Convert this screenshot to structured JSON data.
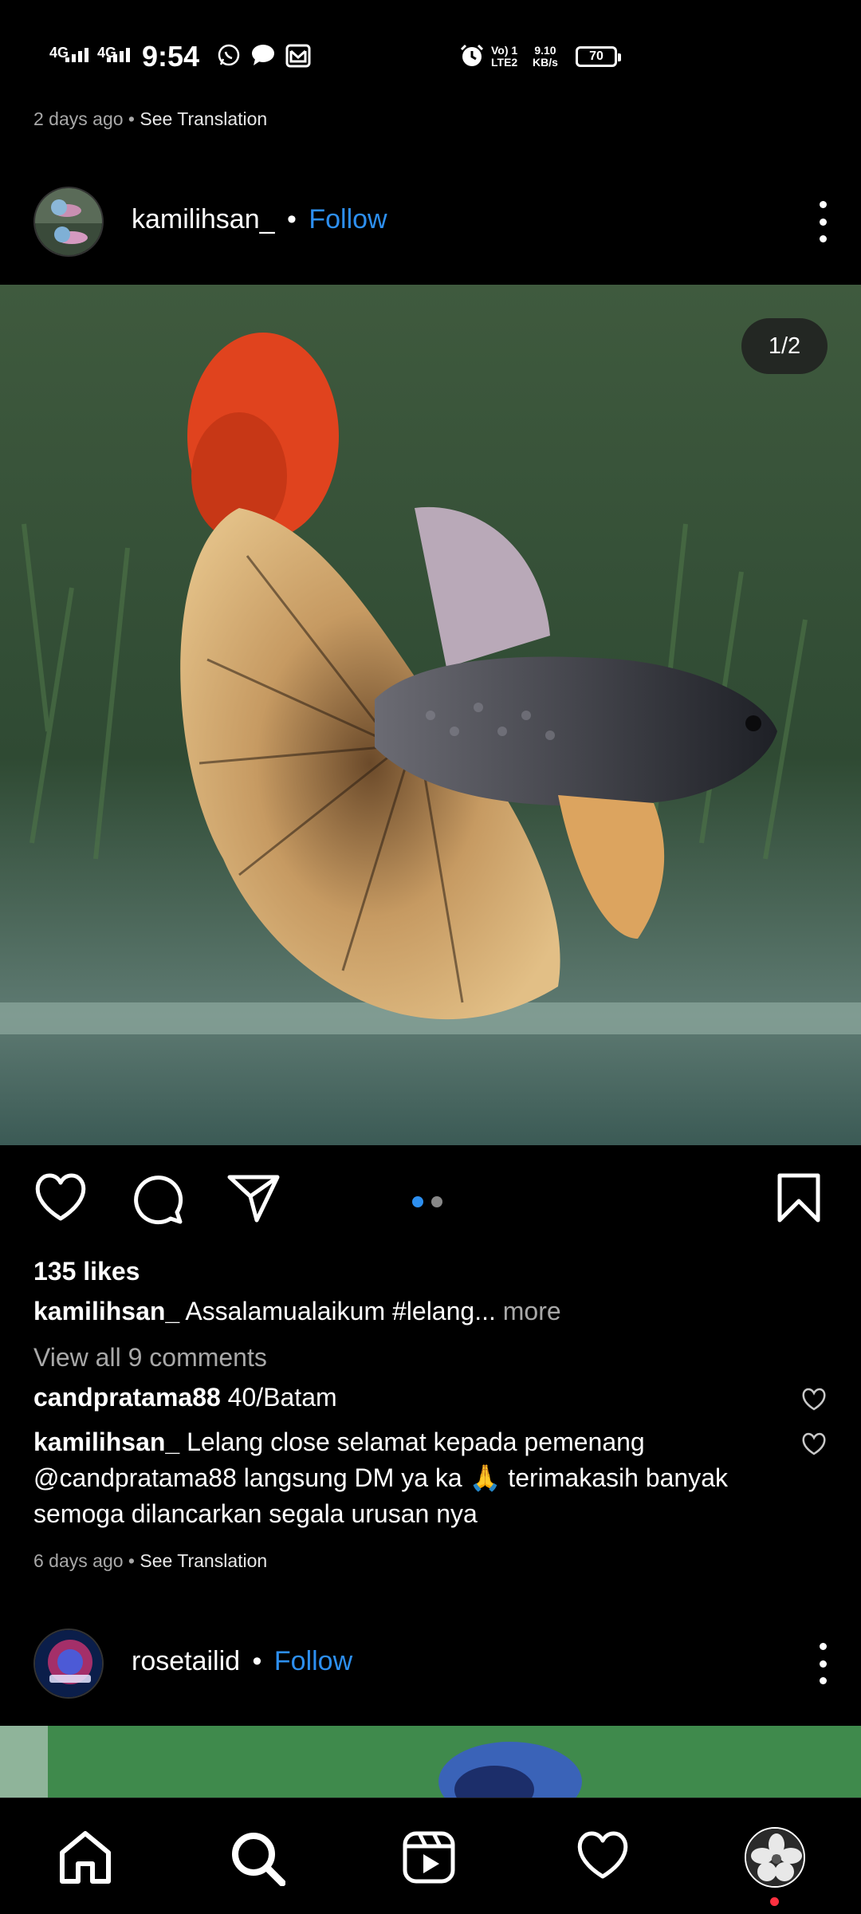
{
  "status_bar": {
    "network_1": "4G",
    "network_2": "4G",
    "time": "9:54",
    "volte_line1": "Vo) 1",
    "volte_line2": "LTE2",
    "speed_line1": "9.10",
    "speed_line2": "KB/s",
    "battery": "70",
    "icons": [
      "whatsapp-icon",
      "message-icon",
      "gmail-icon",
      "alarm-icon"
    ]
  },
  "previous_post": {
    "timestamp": "2 days ago",
    "separator": "•",
    "see_translation": "See Translation"
  },
  "post": {
    "username": "kamilihsan_",
    "separator": "•",
    "follow_label": "Follow",
    "image_counter": "1/2",
    "carousel_total": 2,
    "carousel_active": 1,
    "likes": "135 likes",
    "caption_user": "kamilihsan_",
    "caption_text": "Assalamualaikum #lelang",
    "caption_ellipsis": "...",
    "caption_more": "more",
    "view_all_comments": "View all 9 comments",
    "comments": [
      {
        "user": "candpratama88",
        "text": "40/Batam"
      },
      {
        "user": "kamilihsan_",
        "text": "Lelang close selamat kepada pemenang @candpratama88 langsung DM ya ka 🙏 terimakasih banyak semoga dilancarkan segala urusan nya"
      }
    ],
    "timestamp": "6 days ago",
    "separator2": "•",
    "see_translation": "See Translation"
  },
  "next_post": {
    "username": "rosetailid",
    "separator": "•",
    "follow_label": "Follow"
  },
  "colors": {
    "background": "#000000",
    "accent": "#2d8ff0",
    "muted_text": "#a8a8a8",
    "notification": "#ff3040"
  },
  "bottom_nav": [
    "home-icon",
    "search-icon",
    "reels-icon",
    "heart-icon",
    "profile-avatar"
  ]
}
